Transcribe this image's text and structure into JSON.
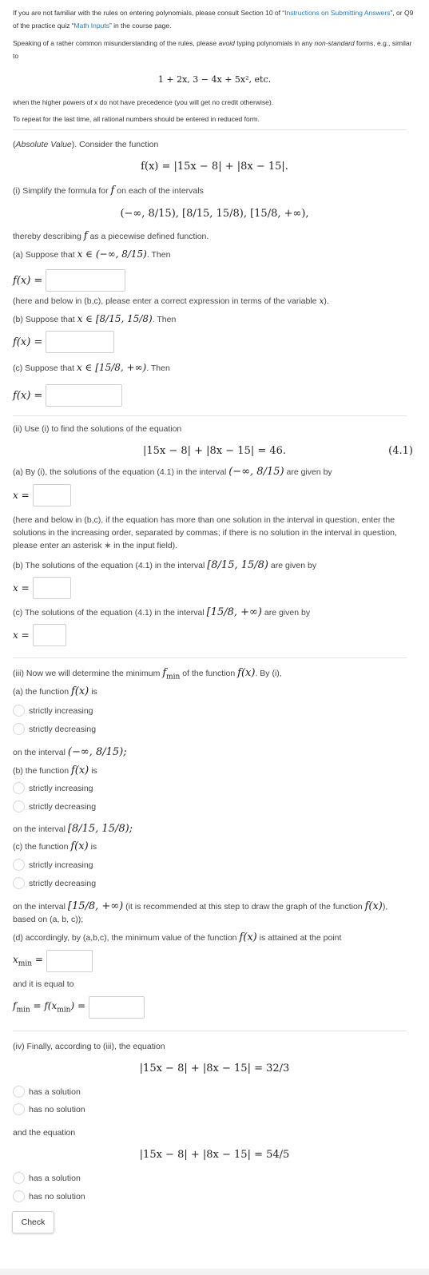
{
  "intro": {
    "p1_pre": "If you are not familiar with the rules on entering polynomials, please consult Section 10 of “",
    "p1_link1": "Instructions on Submitting Answers",
    "p1_mid": "”, or Q9 of the practice quiz “",
    "p1_link2": "Math Inputs",
    "p1_post": "” in the course page.",
    "p2_a": "Speaking of a rather common misunderstanding of the rules, please ",
    "p2_avoid": "avoid",
    "p2_b": " typing polynomials in any ",
    "p2_nonstd": "non-standard",
    "p2_c": " forms, e.g., similar to",
    "example": "1 + 2x, 3 − 4x + 5x², etc.",
    "p3": "when the higher powers of x do not have precedence (you will get no credit otherwise).",
    "p4": "To repeat for the last time, all rational numbers should be entered in reduced form."
  },
  "problem": {
    "header_italic": "Absolute Value",
    "header_rest": "). Consider the function",
    "header_paren": "(",
    "function": "f(x) = |15x − 8| + |8x − 15|."
  },
  "part1": {
    "intro": "(i) Simplify the formula for",
    "intro_f": "f",
    "intro_rest": "on each of the intervals",
    "intervals": "(−∞, 8/15),    [8/15, 15/8),    [15/8, +∞),",
    "thereby_a": "thereby describing",
    "thereby_f": "f",
    "thereby_b": "as a piecewise defined function.",
    "a_text": "(a) Suppose that",
    "a_math": "x ∈ (−∞, 8/15)",
    "then": ". Then",
    "fx": "f(x) =",
    "note": "(here and below in (b,c), please enter a correct expression in terms of the variable",
    "note_var": "x",
    "note_end": ").",
    "b_text": "(b) Suppose that",
    "b_math": "x ∈ [8/15, 15/8)",
    "c_text": "(c) Suppose that",
    "c_math": "x ∈ [15/8, +∞)"
  },
  "part2": {
    "intro": "(ii) Use (i) to find the solutions of the equation",
    "equation": "|15x − 8| + |8x − 15| = 46.",
    "eqnum": "(4.1)",
    "a_text": "(a) By (i), the solutions of the equation (4.1) in the interval",
    "a_math": "(−∞, 8/15)",
    "a_end": "are given by",
    "xeq": "x =",
    "note": "(here and below in (b,c), if the equation has more than one solution in the interval in question, enter the solutions in the increasing order, separated by commas; if there is no solution in the interval in question, please enter an asterisk ∗ in the input field).",
    "b_text": "(b) The solutions of the equation (4.1) in the interval",
    "b_math": "[8/15, 15/8)",
    "c_text": "(c) The solutions of the equation (4.1) in the interval",
    "c_math": "[15/8, +∞)"
  },
  "part3": {
    "intro_a": "(iii) Now we will determine the minimum",
    "intro_fmin": "f",
    "intro_fmin_sub": "min",
    "intro_b": "of the function",
    "intro_fx": "f(x)",
    "intro_c": ". By (i),",
    "a_text": "(a) the function",
    "is": "is",
    "opt_inc": "strictly increasing",
    "opt_dec": "strictly decreasing",
    "on_interval": "on the interval",
    "int_a": "(−∞, 8/15);",
    "b_text": "(b) the function",
    "int_b": "[8/15, 15/8);",
    "c_text": "(c) the function",
    "int_c": "[15/8, +∞)",
    "int_c_note": "(it is recommended at this step to draw the graph of the function",
    "int_c_note_end": "), based on (a, b, c));",
    "d_text": "(d) accordingly, by (a,b,c), the minimum value of the function",
    "d_end": "is attained at the point",
    "xmin": "x",
    "xmin_sub": "min",
    "eq": "=",
    "equal_to": "and it is equal to",
    "fmin_expr_a": "f",
    "fmin_expr_sub": "min",
    "fmin_expr_b": "= f(x",
    "fmin_expr_sub2": "min",
    "fmin_expr_c": ") ="
  },
  "part4": {
    "intro": "(iv) Finally, according to (iii), the equation",
    "eq1": "|15x − 8| + |8x − 15| = 32/3",
    "opt_has": "has a solution",
    "opt_no": "has no solution",
    "and_eq": "and the equation",
    "eq2": "|15x − 8| + |8x − 15| = 54/5"
  },
  "check_label": "Check",
  "colors": {
    "link": "#2a7ab8",
    "text": "#444444",
    "border": "#cfcfcf",
    "divider": "#e2e2e2"
  }
}
